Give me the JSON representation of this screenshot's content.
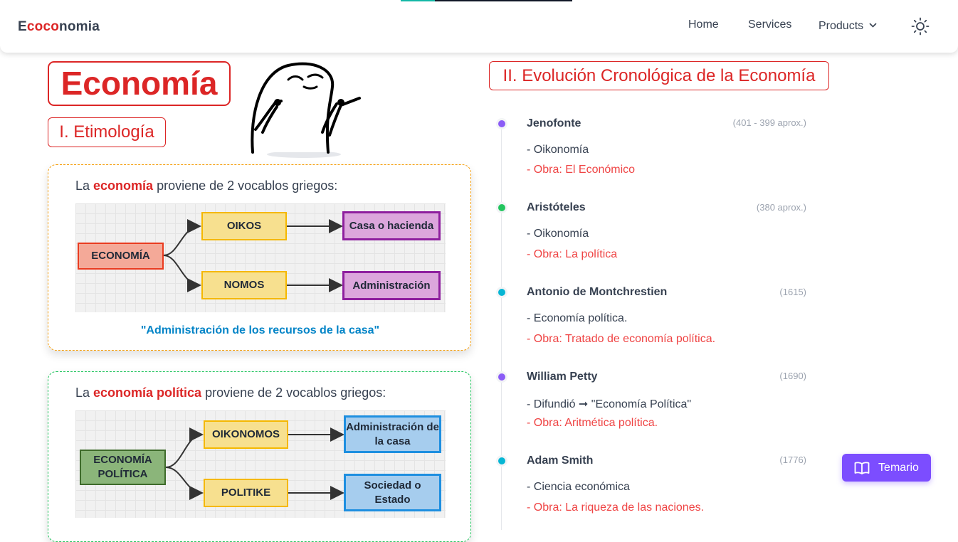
{
  "reading_progress": 0.2,
  "header": {
    "brand_prefix": "E",
    "brand_accent": "coco",
    "brand_suffix": "nomia",
    "nav": {
      "home": "Home",
      "services": "Services",
      "products": "Products"
    },
    "theme_icon": "sun-icon"
  },
  "left": {
    "title": "Economía",
    "section1_title": "I. Etimología",
    "card1": {
      "lead_before": "La ",
      "lead_highlight": "economía",
      "lead_after": " proviene de 2 vocablos griegos:",
      "root": "ECONOMÍA",
      "word1": "OIKOS",
      "meaning1": "Casa o hacienda",
      "word2": "NOMOS",
      "meaning2": "Administración",
      "quote": "\"Administración de los recursos de la casa\""
    },
    "card2": {
      "lead_before": "La ",
      "lead_highlight": "economía política",
      "lead_after": " proviene de 2 vocablos griegos:",
      "root": "ECONOMÍA POLÍTICA",
      "word1": "OIKONOMOS",
      "meaning1": "Administración de la casa",
      "word2": "POLITIKE",
      "meaning2": "Sociedad o Estado"
    }
  },
  "right": {
    "title": "II. Evolución Cronológica de la Economía",
    "timeline": [
      {
        "name": "Jenofonte",
        "date": "(401 - 399 aprox.)",
        "desc": "- Oikonomía",
        "work": "- Obra: El Económico",
        "dot_color": "#8b5cf6"
      },
      {
        "name": "Aristóteles",
        "date": "(380 aprox.)",
        "desc": "- Oikonomía",
        "work": "- Obra: La política",
        "dot_color": "#22c55e"
      },
      {
        "name": "Antonio de Montchrestien",
        "date": "(1615)",
        "desc": "- Economía política.",
        "work": "- Obra: Tratado de economía política.",
        "dot_color": "#06b6d4"
      },
      {
        "name": "William Petty",
        "date": "(1690)",
        "desc": "- Difundió ➞ \"Economía Política\"",
        "work": "- Obra: Aritmética política.",
        "dot_color": "#8b5cf6"
      },
      {
        "name": "Adam Smith",
        "date": "(1776)",
        "desc": "- Ciencia económica",
        "work": "- Obra: La riqueza de las naciones.",
        "dot_color": "#06b6d4"
      }
    ]
  },
  "floating_button": {
    "label": "Temario",
    "icon": "book-icon"
  }
}
